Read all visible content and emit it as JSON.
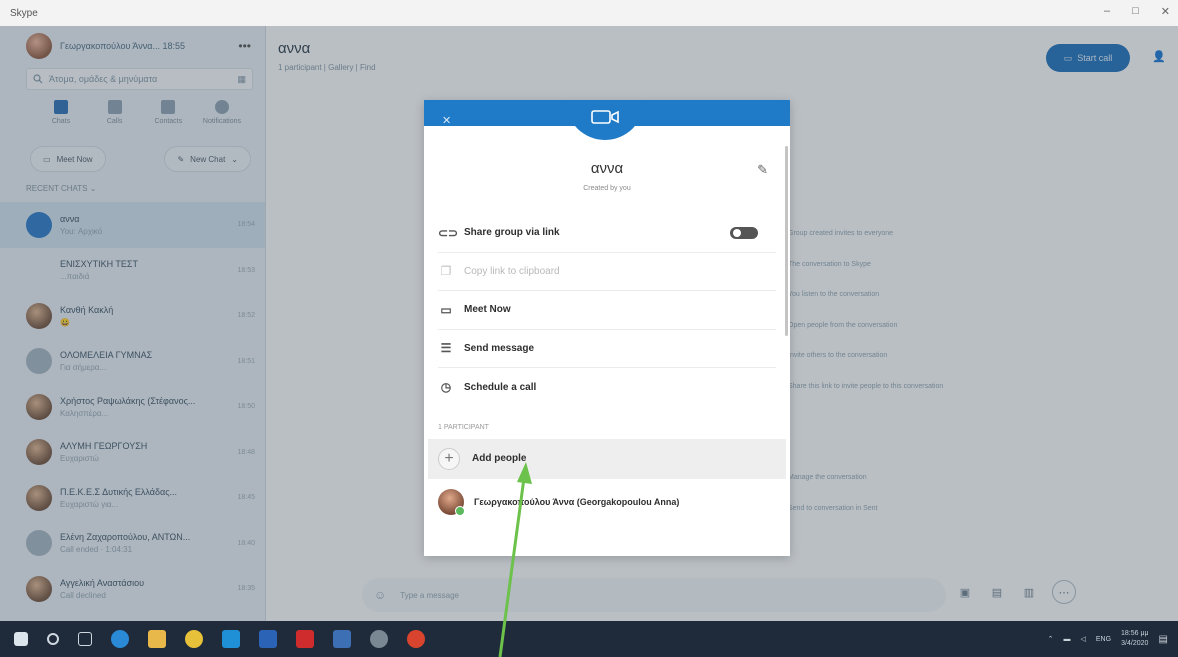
{
  "window": {
    "title": "Skype",
    "controls": [
      "–",
      "□",
      "✕"
    ]
  },
  "sidebar": {
    "profile_name": "Γεωργακοπούλου Άννα... 18:55",
    "more": "•••",
    "search_placeholder": "Άτομα, ομάδες & μηνύματα",
    "nav": [
      {
        "label": "Chats",
        "icon": "chat-icon"
      },
      {
        "label": "Calls",
        "icon": "phone-icon"
      },
      {
        "label": "Contacts",
        "icon": "contacts-icon"
      },
      {
        "label": "Notifications",
        "icon": "bell-icon"
      }
    ],
    "meet_now": "Meet Now",
    "new_chat": "New Chat",
    "recent_label": "RECENT CHATS ⌄",
    "chats": [
      {
        "name": "αννα",
        "sub": "You: Αρχικό",
        "time": "18:54",
        "avatar": "blue",
        "active": true
      },
      {
        "name": "ΕΝΙΣΧΥΤΙΚΗ ΤΕΣΤ",
        "sub": "...παιδιά",
        "time": "18:53",
        "avatar": "empty"
      },
      {
        "name": "Κανθή Κακλή",
        "sub": "😀",
        "time": "18:52",
        "avatar": "photo"
      },
      {
        "name": "ΟΛΟΜΕΛΕΙΑ ΓΥΜΝΑΣ",
        "sub": "Για σήμερα...",
        "time": "18:51",
        "avatar": "grey"
      },
      {
        "name": "Χρήστος Ραψωλάκης (Στέφανος...",
        "sub": "Καλησπέρα...",
        "time": "18:50",
        "avatar": "photo"
      },
      {
        "name": "ΑΛΥΜΗ ΓΕΩΡΓΟΥΣΗ",
        "sub": "Ευχαριστώ",
        "time": "18:48",
        "avatar": "photo"
      },
      {
        "name": "Π.Ε.Κ.Ε.Σ Δυτικής Ελλάδας...",
        "sub": "Ευχαριστώ για...",
        "time": "18:45",
        "avatar": "photo"
      },
      {
        "name": "Ελένη Ζαχαροπούλου, ΑΝΤΩΝ...",
        "sub": "Call ended · 1:04:31",
        "time": "18:40",
        "avatar": "grey"
      },
      {
        "name": "Αγγελική Αναστάσιου",
        "sub": "Call declined",
        "time": "18:35",
        "avatar": "photo"
      }
    ]
  },
  "conversation": {
    "title": "αννα",
    "subtitle": "1 participant | Gallery | Find",
    "start_call": "Start call",
    "background_items": [
      "Group created invites to everyone",
      "The conversation to Skype",
      "You listen to the conversation",
      "Open people from the conversation",
      "Invite others to the conversation",
      "Share this link to invite people to this conversation",
      "",
      "",
      "Manage the conversation",
      "Send to conversation in Sent"
    ],
    "compose_placeholder": "Type a message"
  },
  "modal": {
    "group_name": "αννα",
    "created_by": "Created by you",
    "menu": [
      {
        "label": "Share group via link",
        "icon": "link-icon",
        "disabled": false,
        "toggle": true
      },
      {
        "label": "Copy link to clipboard",
        "icon": "copy-icon",
        "disabled": true
      },
      {
        "label": "Meet Now",
        "icon": "video-icon",
        "disabled": false
      },
      {
        "label": "Send message",
        "icon": "message-icon",
        "disabled": false
      },
      {
        "label": "Schedule a call",
        "icon": "calendar-icon",
        "disabled": false
      }
    ],
    "participants_label": "1 PARTICIPANT",
    "add_people": "Add people",
    "participant_name": "Γεωργακοπούλου Άννα (Georgakopoulou Anna)"
  },
  "taskbar": {
    "tray_lang": "ENG",
    "time": "18:56 μμ",
    "date": "3/4/2020"
  },
  "colors": {
    "accent": "#1f7ac7",
    "arrow": "#6cc24a",
    "taskbar": "#1f2b3a"
  }
}
